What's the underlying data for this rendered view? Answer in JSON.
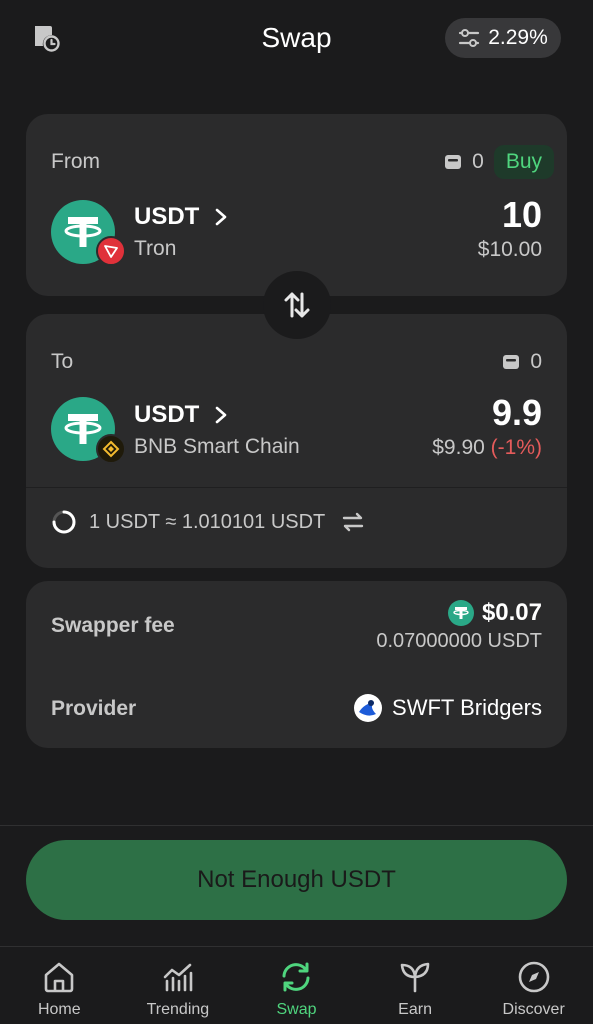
{
  "header": {
    "title": "Swap",
    "slippage": "2.29%"
  },
  "from": {
    "label": "From",
    "balance": "0",
    "buy_label": "Buy",
    "token": "USDT",
    "chain": "Tron",
    "amount": "10",
    "fiat": "$10.00"
  },
  "to": {
    "label": "To",
    "balance": "0",
    "token": "USDT",
    "chain": "BNB Smart Chain",
    "amount": "9.9",
    "fiat": "$9.90",
    "change": "(-1%)"
  },
  "rate": {
    "text": "1 USDT ≈ 1.010101 USDT"
  },
  "fee": {
    "label": "Swapper fee",
    "usd": "$0.07",
    "token_amount": "0.07000000 USDT",
    "provider_label": "Provider",
    "provider": "SWFT Bridgers"
  },
  "action": {
    "label": "Not Enough USDT"
  },
  "nav": {
    "items": [
      {
        "label": "Home",
        "icon": "home-icon"
      },
      {
        "label": "Trending",
        "icon": "trending-icon"
      },
      {
        "label": "Swap",
        "icon": "swap-icon"
      },
      {
        "label": "Earn",
        "icon": "earn-icon"
      },
      {
        "label": "Discover",
        "icon": "discover-icon"
      }
    ]
  },
  "colors": {
    "background": "#1b1b1c",
    "card": "#2b2b2c",
    "accent": "#4fd57e",
    "button": "#2d7046",
    "negative": "#e55b5b",
    "tether": "#2aa887",
    "tron": "#e0313a",
    "bnb": "#f3ba2f"
  }
}
